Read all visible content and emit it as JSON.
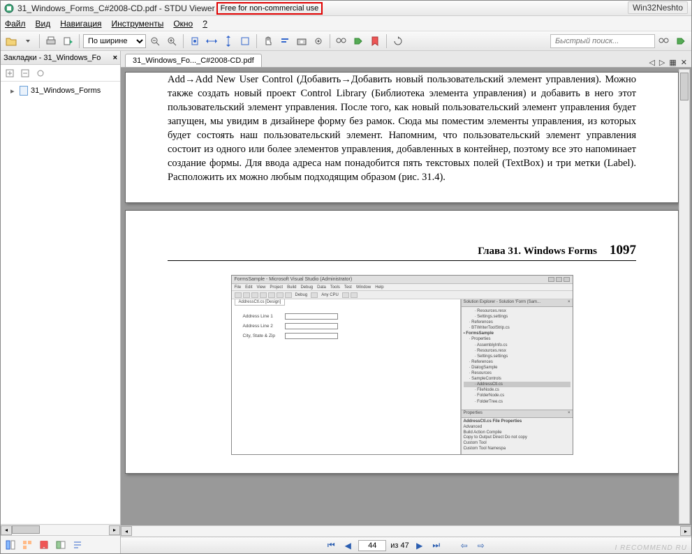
{
  "titlebar": {
    "filename": "31_Windows_Forms_C#2008-CD.pdf",
    "app": "STDU Viewer",
    "license_note": "Free for non-commercial use",
    "win32_tag": "Win32Neshto"
  },
  "menu": {
    "file": "Файл",
    "view": "Вид",
    "navigation": "Навигация",
    "tools": "Инструменты",
    "window": "Окно",
    "help": "?"
  },
  "toolbar": {
    "zoom_mode": "По ширине",
    "quicksearch_placeholder": "Быстрый поиск..."
  },
  "sidebar": {
    "title_prefix": "Закладки",
    "title_file": "31_Windows_Fo",
    "tree_item": "31_Windows_Forms"
  },
  "tab": {
    "label": "31_Windows_Fo..._C#2008-CD.pdf"
  },
  "page1": {
    "body": "Add→Add New User Control (Добавить→Добавить новый пользовательский элемент управления). Можно также создать новый проект Control Library (Библиотека элемента управления) и добавить в него этот пользовательский элемент управления. После того, как новый пользовательский элемент управления будет запущен, мы увидим в дизайнере форму без рамок. Сюда мы поместим элементы управления, из которых будет состоять наш пользовательский элемент. Напомним, что пользовательский элемент управления состоит из одного или более элементов управления, добавленных в контейнер, поэтому все это напоминает создание формы. Для ввода адреса нам понадобится пять текстовых полей (TextBox) и три метки (Label). Расположить их можно любым подходящим образом (рис. 31.4)."
  },
  "page2": {
    "chapter_label": "Глава 31. Windows Forms",
    "page_number": "1097",
    "vs": {
      "title": "FormsSample - Microsoft Visual Studio (Administrator)",
      "menus": [
        "File",
        "Edit",
        "View",
        "Project",
        "Build",
        "Debug",
        "Data",
        "Tools",
        "Test",
        "Window",
        "Help"
      ],
      "config": "Debug",
      "platform": "Any CPU",
      "designer_tab": "AddressCtl.cs [Design]",
      "fields": [
        {
          "label": "Address Line 1"
        },
        {
          "label": "Address Line 2"
        },
        {
          "label": "City, State & Zip"
        }
      ],
      "solution_panel": "Solution Explorer - Solution 'Form (Sam...",
      "tree": [
        {
          "t": "Resources.resx",
          "i": 2
        },
        {
          "t": "Settings.settings",
          "i": 2
        },
        {
          "t": "References",
          "i": 1
        },
        {
          "t": "BTWriterToolStrip.cs",
          "i": 1
        },
        {
          "t": "FormsSample",
          "i": 0,
          "b": true
        },
        {
          "t": "Properties",
          "i": 1
        },
        {
          "t": "AssemblyInfo.cs",
          "i": 2
        },
        {
          "t": "Resources.resx",
          "i": 2
        },
        {
          "t": "Settings.settings",
          "i": 2
        },
        {
          "t": "References",
          "i": 1
        },
        {
          "t": "DialogSample",
          "i": 1
        },
        {
          "t": "Resources",
          "i": 1
        },
        {
          "t": "SampleControls",
          "i": 1
        },
        {
          "t": "AddressCtl.cs",
          "i": 2,
          "sel": true
        },
        {
          "t": "FileNode.cs",
          "i": 2
        },
        {
          "t": "FolderNode.cs",
          "i": 2
        },
        {
          "t": "FolderTree.cs",
          "i": 2
        }
      ],
      "props_title": "Properties",
      "props_header": "AddressCtl.cs File Properties",
      "props_rows": [
        "Advanced",
        "Build Action            Compile",
        "Copy to Output Direct  Do not copy",
        "Custom Tool",
        "Custom Tool Namespa"
      ]
    }
  },
  "pagenav": {
    "current": "44",
    "of_word": "из",
    "total": "47",
    "watermark": "I RECOMMEND RU"
  }
}
